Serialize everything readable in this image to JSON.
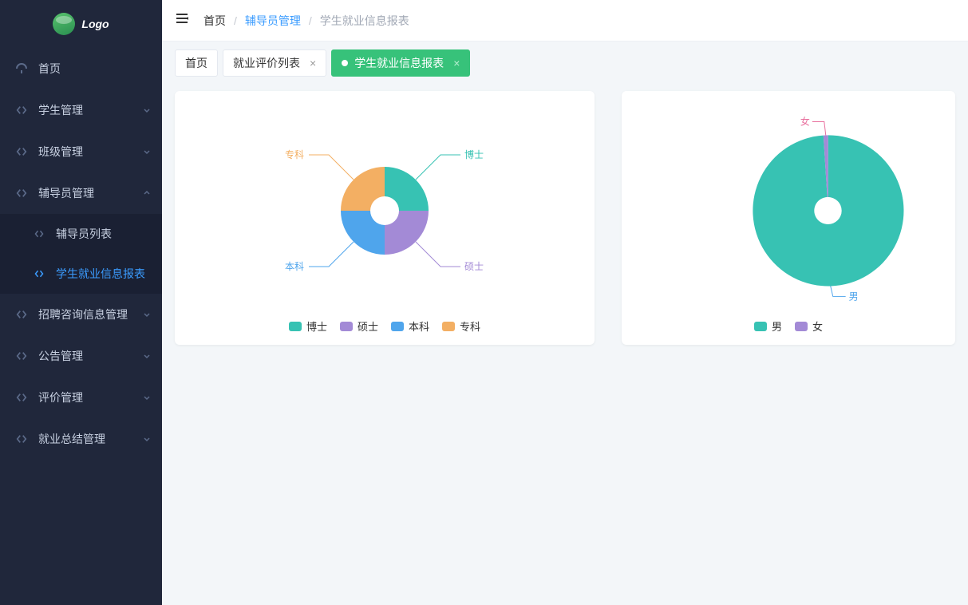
{
  "logo": {
    "text": "Logo"
  },
  "sidebar": {
    "items": [
      {
        "label": "首页",
        "icon": "dashboard",
        "hasChildren": false
      },
      {
        "label": "学生管理",
        "icon": "code",
        "hasChildren": true
      },
      {
        "label": "班级管理",
        "icon": "code",
        "hasChildren": true
      },
      {
        "label": "辅导员管理",
        "icon": "code",
        "hasChildren": true,
        "expanded": true,
        "children": [
          {
            "label": "辅导员列表",
            "icon": "code",
            "active": false
          },
          {
            "label": "学生就业信息报表",
            "icon": "code",
            "active": true
          }
        ]
      },
      {
        "label": "招聘咨询信息管理",
        "icon": "code",
        "hasChildren": true
      },
      {
        "label": "公告管理",
        "icon": "code",
        "hasChildren": true
      },
      {
        "label": "评价管理",
        "icon": "code",
        "hasChildren": true
      },
      {
        "label": "就业总结管理",
        "icon": "code",
        "hasChildren": true
      }
    ]
  },
  "breadcrumb": {
    "home": "首页",
    "section": "辅导员管理",
    "page": "学生就业信息报表"
  },
  "tabs": [
    {
      "label": "首页",
      "closable": false,
      "active": false
    },
    {
      "label": "就业评价列表",
      "closable": true,
      "active": false
    },
    {
      "label": "学生就业信息报表",
      "closable": true,
      "active": true
    }
  ],
  "colors": {
    "teal": "#37c2b3",
    "purple": "#a38ad6",
    "blue": "#4fa5ec",
    "orange": "#f3af63",
    "pink": "#e86f9d"
  },
  "chart_data": [
    {
      "type": "pie",
      "inner_radius": 0.32,
      "series": [
        {
          "name": "博士",
          "value": 25,
          "color": "teal"
        },
        {
          "name": "硕士",
          "value": 25,
          "color": "purple"
        },
        {
          "name": "本科",
          "value": 25,
          "color": "blue"
        },
        {
          "name": "专科",
          "value": 25,
          "color": "orange"
        }
      ],
      "labels": {
        "doctor": "博士",
        "master": "硕士",
        "bachelor": "本科",
        "junior": "专科"
      }
    },
    {
      "type": "pie",
      "inner_radius": 0.18,
      "series": [
        {
          "name": "男",
          "value": 99,
          "color": "teal"
        },
        {
          "name": "女",
          "value": 1,
          "color": "purple"
        }
      ],
      "labels": {
        "male": "男",
        "female": "女"
      }
    }
  ]
}
